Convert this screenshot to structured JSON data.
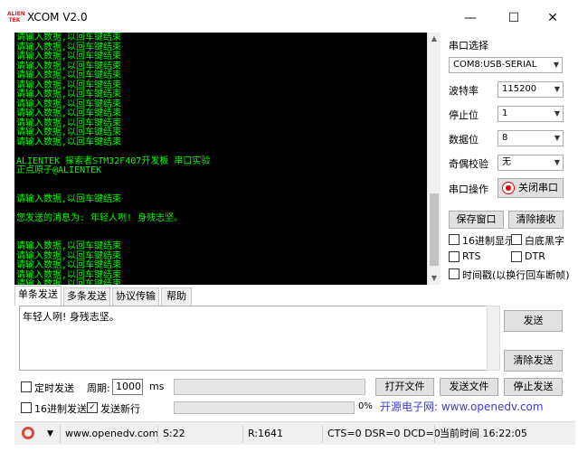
{
  "window": {
    "title": "XCOM V2.0",
    "logo_text": "ALIEN TEK"
  },
  "terminal": {
    "lines": [
      "请输入数据,以回车键结束",
      "请输入数据,以回车键结束",
      "请输入数据,以回车键结束",
      "请输入数据,以回车键结束",
      "请输入数据,以回车键结束",
      "请输入数据,以回车键结束",
      "请输入数据,以回车键结束",
      "请输入数据,以回车键结束",
      "请输入数据,以回车键结束",
      "请输入数据,以回车键结束",
      "请输入数据,以回车键结束",
      "请输入数据,以回车键结束",
      "",
      "ALIENTEK 探索者STM32F407开发板 串口实验",
      "正点原子@ALIENTEK",
      "",
      "",
      "请输入数据,以回车键结束",
      "",
      "您发送的消息为: 年轻人咧! 身残志坚。",
      "",
      "",
      "请输入数据,以回车键结束",
      "请输入数据,以回车键结束",
      "请输入数据,以回车键结束",
      "请输入数据,以回车键结束",
      "请输入数据,以回车键结束"
    ]
  },
  "side": {
    "port_select_label": "串口选择",
    "port_value": "COM8:USB-SERIAL",
    "baud_label": "波特率",
    "baud_value": "115200",
    "stopbit_label": "停止位",
    "stopbit_value": "1",
    "databit_label": "数据位",
    "databit_value": "8",
    "parity_label": "奇偶校验",
    "parity_value": "无",
    "serial_op_label": "串口操作",
    "close_port_label": "关闭串口",
    "save_window_label": "保存窗口",
    "clear_recv_label": "清除接收",
    "hex_display_label": "16进制显示",
    "white_bg_label": "白底黑字",
    "rts_label": "RTS",
    "dtr_label": "DTR",
    "timestamp_label": "时间戳(以换行回车断帧)"
  },
  "tabs": [
    "单条发送",
    "多条发送",
    "协议传输",
    "帮助"
  ],
  "send": {
    "text": "年轻人咧! 身残志坚。",
    "send_button": "发送",
    "clear_send_button": "清除发送"
  },
  "bottom": {
    "timed_send_label": "定时发送",
    "period_label": "周期:",
    "period_value": "1000",
    "ms_label": "ms",
    "open_file_label": "打开文件",
    "send_file_label": "发送文件",
    "stop_send_label": "停止发送",
    "hex_send_label": "16进制发送",
    "send_newline_label": "发送新行",
    "progress_text": "0%",
    "banner_text": "开源电子网: www.openedv.com"
  },
  "status": {
    "url": "www.openedv.com",
    "sent": "S:22",
    "received": "R:1641",
    "lines": "CTS=0 DSR=0 DCD=0",
    "time": "当前时间 16:22:05"
  }
}
